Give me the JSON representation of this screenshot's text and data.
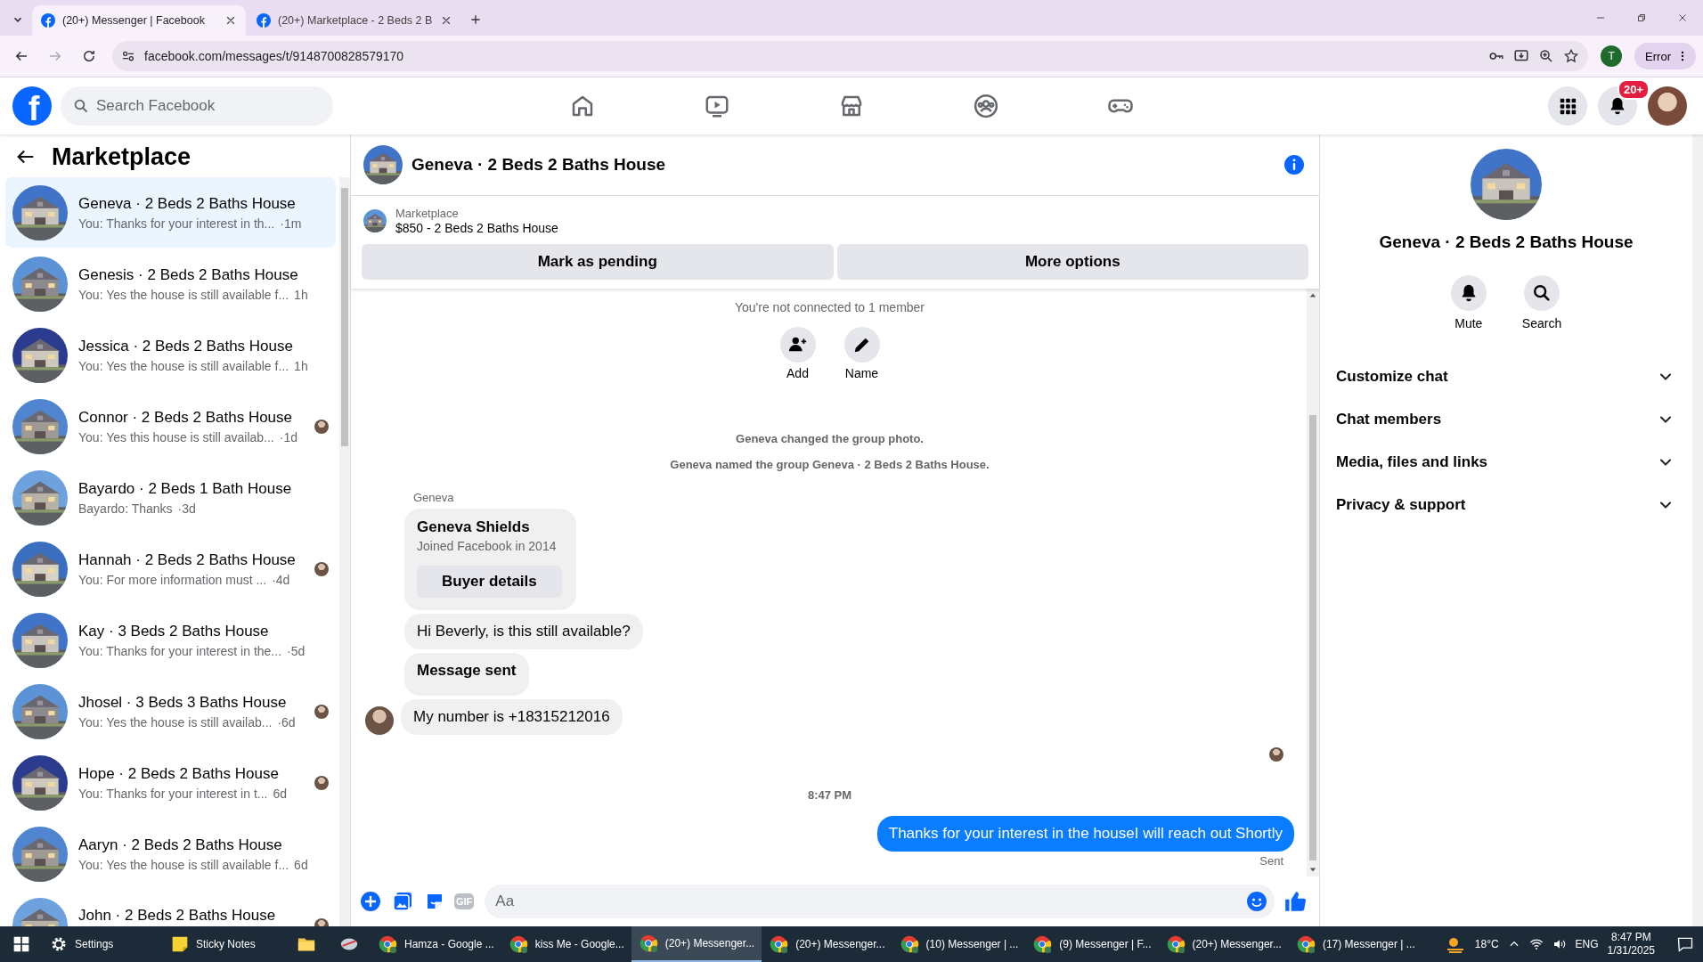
{
  "browser": {
    "tabs": [
      {
        "title": "(20+) Messenger | Facebook",
        "selected": true
      },
      {
        "title": "(20+) Marketplace - 2 Beds 2 B",
        "selected": false
      }
    ],
    "url": "facebook.com/messages/t/9148700828579170",
    "profile_initial": "T",
    "error_button": "Error"
  },
  "facebook_header": {
    "logo": "f",
    "search_placeholder": "Search Facebook",
    "notification_badge": "20+"
  },
  "sidebar": {
    "title": "Marketplace",
    "conversations": [
      {
        "title": "Geneva · 2 Beds 2 Baths House",
        "preview": "You: Thanks for your interest in th...",
        "time": "·1m",
        "selected": true,
        "read_receipt": false
      },
      {
        "title": "Genesis · 2 Beds 2 Baths House",
        "preview": "You: Yes the house is still available f...",
        "time": "1h",
        "selected": false,
        "read_receipt": false
      },
      {
        "title": "Jessica · 2 Beds 2 Baths House",
        "preview": "You: Yes the house is still available f...",
        "time": "1h",
        "selected": false,
        "read_receipt": false
      },
      {
        "title": "Connor · 2 Beds 2 Baths House",
        "preview": "You: Yes this house is still availab...",
        "time": "·1d",
        "selected": false,
        "read_receipt": true
      },
      {
        "title": "Bayardo · 2 Beds 1 Bath House",
        "preview": "Bayardo: Thanks",
        "time": "·3d",
        "selected": false,
        "read_receipt": false
      },
      {
        "title": "Hannah · 2 Beds 2 Baths House",
        "preview": "You: For more information must ...",
        "time": "·4d",
        "selected": false,
        "read_receipt": true
      },
      {
        "title": "Kay · 3 Beds 2 Baths House",
        "preview": "You: Thanks for your interest in the...",
        "time": "·5d",
        "selected": false,
        "read_receipt": false
      },
      {
        "title": "Jhosel · 3 Beds 3 Baths House",
        "preview": "You: Yes the house is still availab...",
        "time": "·6d",
        "selected": false,
        "read_receipt": true
      },
      {
        "title": "Hope · 2 Beds 2 Baths House",
        "preview": "You: Thanks for your interest in t...",
        "time": "6d",
        "selected": false,
        "read_receipt": true
      },
      {
        "title": "Aaryn · 2 Beds 2 Baths House",
        "preview": "You: Yes the house is still available f...",
        "time": "6d",
        "selected": false,
        "read_receipt": false
      },
      {
        "title": "John · 2 Beds 2 Baths House",
        "selected": false,
        "read_receipt": true
      }
    ]
  },
  "chat": {
    "title": "Geneva · 2 Beds 2 Baths House",
    "listing": {
      "label": "Marketplace",
      "title": "$850 - 2 Beds 2 Baths House"
    },
    "actions": [
      "Mark as pending",
      "More options"
    ],
    "messages": [
      {
        "kind": "notice",
        "text": "You're not connected to 1 member"
      },
      {
        "kind": "actions",
        "items": [
          "Add",
          "Name"
        ]
      },
      {
        "kind": "event",
        "text": "Geneva changed the group photo."
      },
      {
        "kind": "event",
        "text": "Geneva named the group Geneva · 2 Beds 2 Baths House."
      },
      {
        "kind": "sender",
        "text": "Geneva"
      },
      {
        "kind": "profile_card",
        "name": "Geneva Shields",
        "subtitle": "Joined Facebook in 2014",
        "button": "Buyer details"
      },
      {
        "kind": "incoming",
        "text": "Hi Beverly, is this still available?",
        "bold": false,
        "avatar": false
      },
      {
        "kind": "incoming",
        "text": "Message sent",
        "bold": true,
        "avatar": false
      },
      {
        "kind": "incoming",
        "text": "My number is +18315212016",
        "bold": false,
        "avatar": true
      },
      {
        "kind": "receipt"
      },
      {
        "kind": "timestamp",
        "text": "8:47 PM"
      },
      {
        "kind": "outgoing",
        "text": "Thanks for your interest in the houseI will reach out Shortly"
      },
      {
        "kind": "status",
        "text": "Sent"
      }
    ],
    "composer": {
      "gif_label": "GIF",
      "placeholder": "Aa"
    }
  },
  "info_panel": {
    "title": "Geneva · 2 Beds 2 Baths House",
    "actions": [
      "Mute",
      "Search"
    ],
    "sections": [
      {
        "label": "Customize chat",
        "expanded": false
      },
      {
        "label": "Chat members",
        "expanded": false
      },
      {
        "label": "Media, files and links",
        "expanded": false
      },
      {
        "label": "Privacy & support",
        "expanded": false
      }
    ]
  },
  "taskbar": {
    "apps": [
      {
        "kind": "settings",
        "label": "Settings",
        "selected": false
      },
      {
        "kind": "notes",
        "label": "Sticky Notes",
        "selected": false
      },
      {
        "kind": "folder",
        "selected": false
      },
      {
        "kind": "app",
        "selected": false
      },
      {
        "kind": "chrome",
        "label": "Hamza - Google ...",
        "selected": false
      },
      {
        "kind": "chrome",
        "label": "kiss Me - Google...",
        "selected": false
      },
      {
        "kind": "chrome",
        "label": "(20+) Messenger...",
        "selected": true
      },
      {
        "kind": "chrome",
        "label": "(20+) Messenger...",
        "selected": false
      },
      {
        "kind": "chrome",
        "label": "(10) Messenger | ...",
        "selected": false
      },
      {
        "kind": "chrome",
        "label": "(9) Messenger | F...",
        "selected": false
      },
      {
        "kind": "chrome",
        "label": "(20+) Messenger...",
        "selected": false
      },
      {
        "kind": "chrome",
        "label": "(17) Messenger | ...",
        "selected": false
      }
    ],
    "weather": "18°C",
    "language": "ENG",
    "time": "8:47 PM",
    "date": "1/31/2025"
  }
}
